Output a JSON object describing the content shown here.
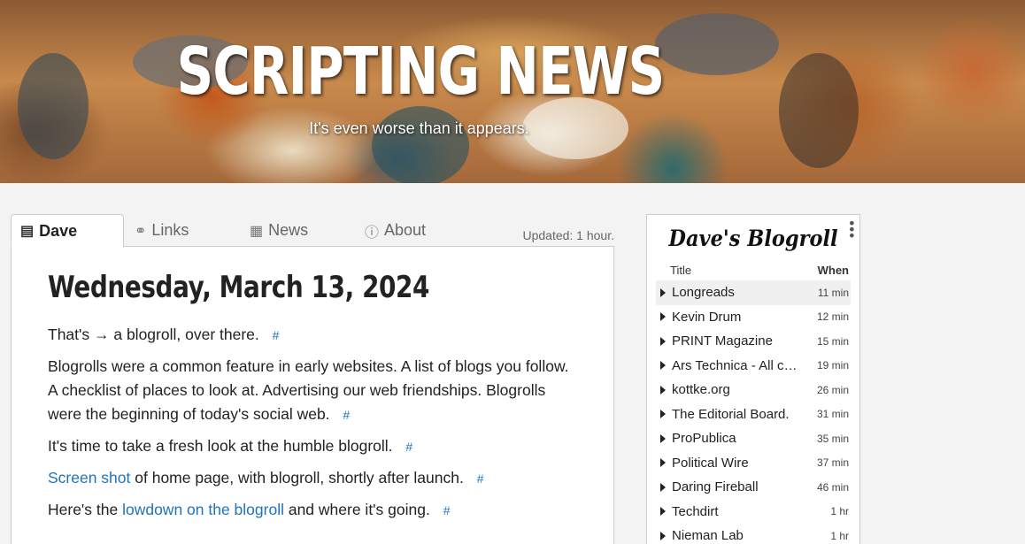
{
  "header": {
    "title": "SCRIPTING NEWS",
    "tagline": "It's even worse than it appears."
  },
  "tabs": [
    {
      "label": "Dave",
      "icon": "book-icon",
      "active": true
    },
    {
      "label": "Links",
      "icon": "link-icon",
      "active": false
    },
    {
      "label": "News",
      "icon": "newspaper-icon",
      "active": false
    },
    {
      "label": "About",
      "icon": "info-circle-icon",
      "active": false
    }
  ],
  "updated": "Updated: 1 hour.",
  "post": {
    "date": "Wednesday, March 13, 2024",
    "paragraphs": [
      {
        "before": "That's",
        "arrow": "→",
        "after": " a blogroll, over there."
      },
      {
        "text": "Blogrolls were a common feature in early websites. A list of blogs you follow. A checklist of places to look at. Advertising our web friendships. Blogrolls were the beginning of today's social web."
      },
      {
        "text": "It's time to take a fresh look at the humble blogroll."
      },
      {
        "link": "Screen shot",
        "after": " of home page, with blogroll, shortly after launch."
      },
      {
        "before": "Here's the ",
        "link": "lowdown on the blogroll",
        "after": " and where it's going."
      }
    ],
    "permalink_symbol": "#"
  },
  "blogroll": {
    "title": "Dave's Blogroll",
    "col_title": "Title",
    "col_when": "When",
    "items": [
      {
        "name": "Longreads",
        "when": "11 min"
      },
      {
        "name": "Kevin Drum",
        "when": "12 min"
      },
      {
        "name": "PRINT Magazine",
        "when": "15 min"
      },
      {
        "name": "Ars Technica - All con…",
        "when": "19 min"
      },
      {
        "name": "kottke.org",
        "when": "26 min"
      },
      {
        "name": "The Editorial Board.",
        "when": "31 min"
      },
      {
        "name": "ProPublica",
        "when": "35 min"
      },
      {
        "name": "Political Wire",
        "when": "37 min"
      },
      {
        "name": "Daring Fireball",
        "when": "46 min"
      },
      {
        "name": "Techdirt",
        "when": "1 hr"
      },
      {
        "name": "Nieman Lab",
        "when": "1 hr"
      }
    ]
  },
  "colors": {
    "link": "#1e73be",
    "permalink": "#c4a8d6",
    "background": "#f3f3f3"
  }
}
